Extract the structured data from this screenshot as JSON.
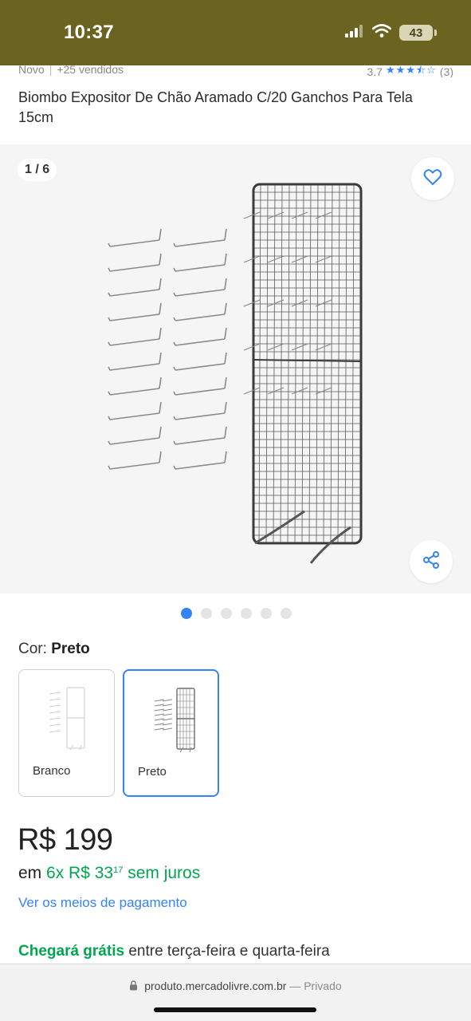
{
  "status_bar": {
    "time": "10:37",
    "battery": "43",
    "icons": [
      "signal-icon",
      "wifi-icon",
      "battery-icon"
    ]
  },
  "meta": {
    "condition": "Novo",
    "sold": "+25 vendidos",
    "rating": "3.7",
    "stars": "★★★⯪☆",
    "reviews": "(3)"
  },
  "product": {
    "title": "Biombo Expositor De Chão Aramado C/20 Ganchos Para Tela 15cm"
  },
  "gallery": {
    "counter": "1 / 6",
    "pages": 6,
    "active_page": 1,
    "favorite_icon": "heart-icon",
    "share_icon": "share-icon"
  },
  "color": {
    "label": "Cor:",
    "selected": "Preto",
    "variants": [
      {
        "name": "Branco",
        "selected": false
      },
      {
        "name": "Preto",
        "selected": true
      }
    ]
  },
  "price": {
    "main": "R$ 199",
    "prefix": "em",
    "installments": "6x R$ 33",
    "cents": "17",
    "suffix": "sem juros",
    "payment_link": "Ver os meios de pagamento"
  },
  "shipping": {
    "highlight": "Chegará grátis",
    "text": "entre terça-feira e quarta-feira"
  },
  "browser": {
    "url": "produto.mercadolivre.com.br",
    "dash": " — ",
    "private": "Privado"
  },
  "colors": {
    "accent": "#3483fa",
    "green": "#00a650",
    "status_bar": "#6b6420"
  }
}
